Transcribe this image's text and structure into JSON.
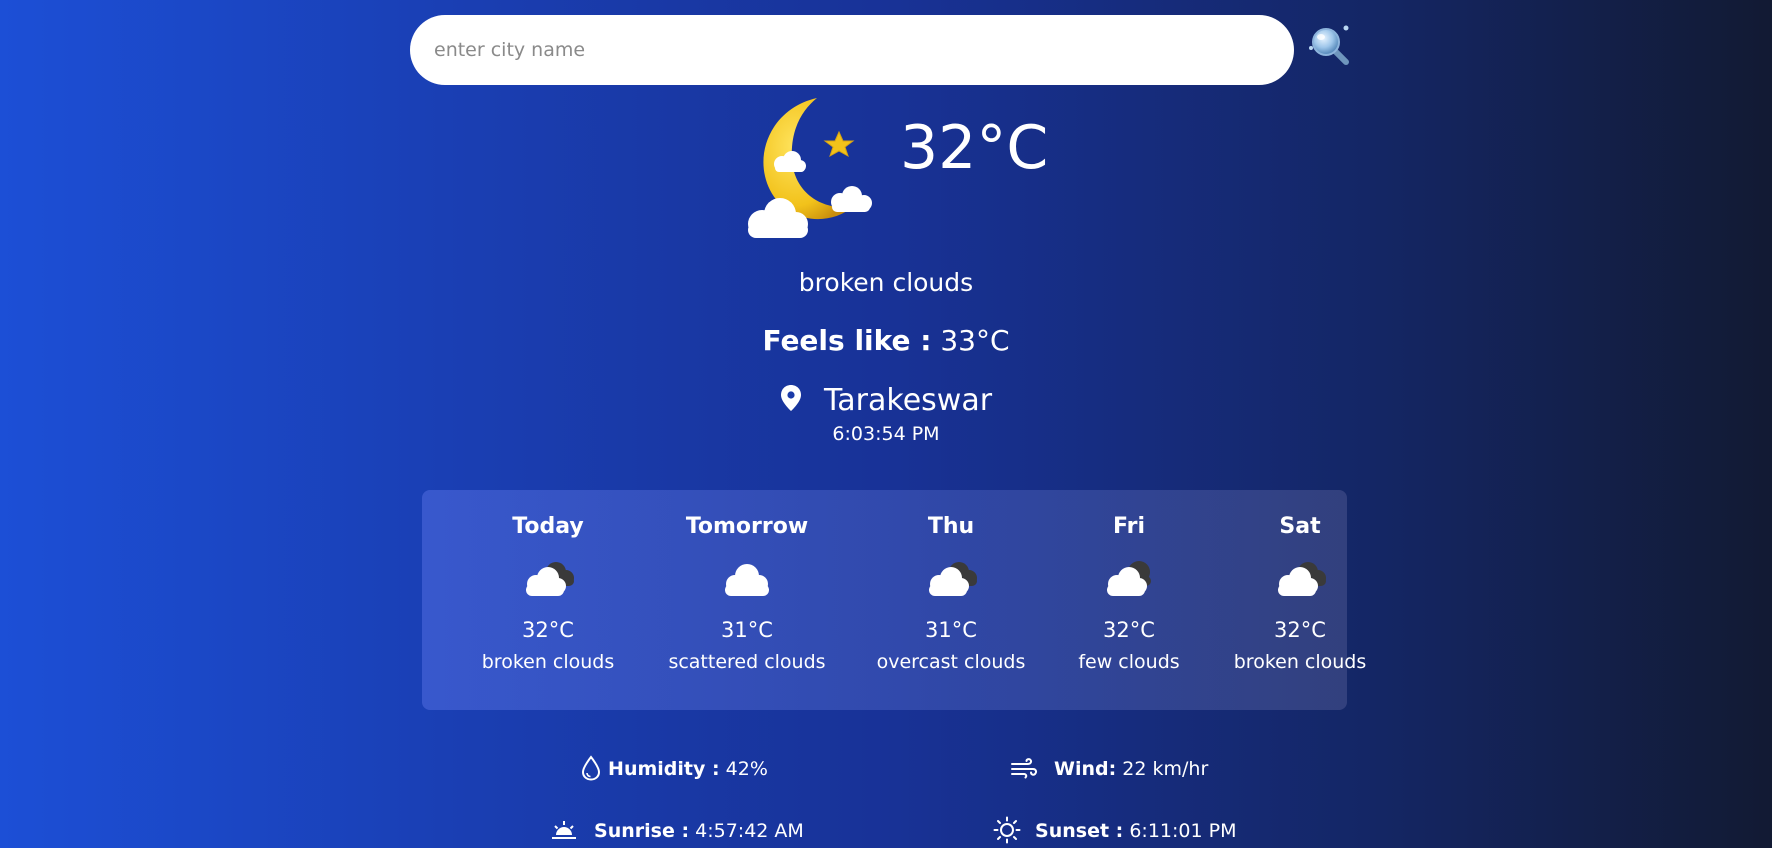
{
  "search": {
    "placeholder": "enter city name",
    "value": "",
    "button_icon": "magnifier-icon"
  },
  "current": {
    "icon": "night-moon-clouds-icon",
    "temperature": "32°C",
    "description": "broken clouds",
    "feels_like_label": "Feels like :",
    "feels_like_value": "33°C",
    "location_icon": "map-pin-icon",
    "city": "Tarakeswar",
    "time": "6:03:54 PM"
  },
  "forecast": [
    {
      "day": "Today",
      "icon": "broken-clouds-icon",
      "temp": "32°C",
      "desc": "broken clouds"
    },
    {
      "day": "Tomorrow",
      "icon": "scattered-clouds-icon",
      "temp": "31°C",
      "desc": "scattered clouds"
    },
    {
      "day": "Thu",
      "icon": "overcast-clouds-icon",
      "temp": "31°C",
      "desc": "overcast clouds"
    },
    {
      "day": "Fri",
      "icon": "few-clouds-icon",
      "temp": "32°C",
      "desc": "few clouds"
    },
    {
      "day": "Sat",
      "icon": "broken-clouds-icon",
      "temp": "32°C",
      "desc": "broken clouds"
    }
  ],
  "details": {
    "humidity_label": "Humidity :",
    "humidity_value": "42%",
    "wind_label": "Wind:",
    "wind_value": "22 km/hr",
    "sunrise_label": "Sunrise :",
    "sunrise_value": "4:57:42 AM",
    "sunset_label": "Sunset :",
    "sunset_value": "6:11:01 PM"
  },
  "colors": {
    "background_left": "#1c4fd6",
    "background_right": "#121a33",
    "moon": "#f2c21b",
    "cloud": "#ffffff",
    "dark_cloud": "#3a3a3a"
  }
}
